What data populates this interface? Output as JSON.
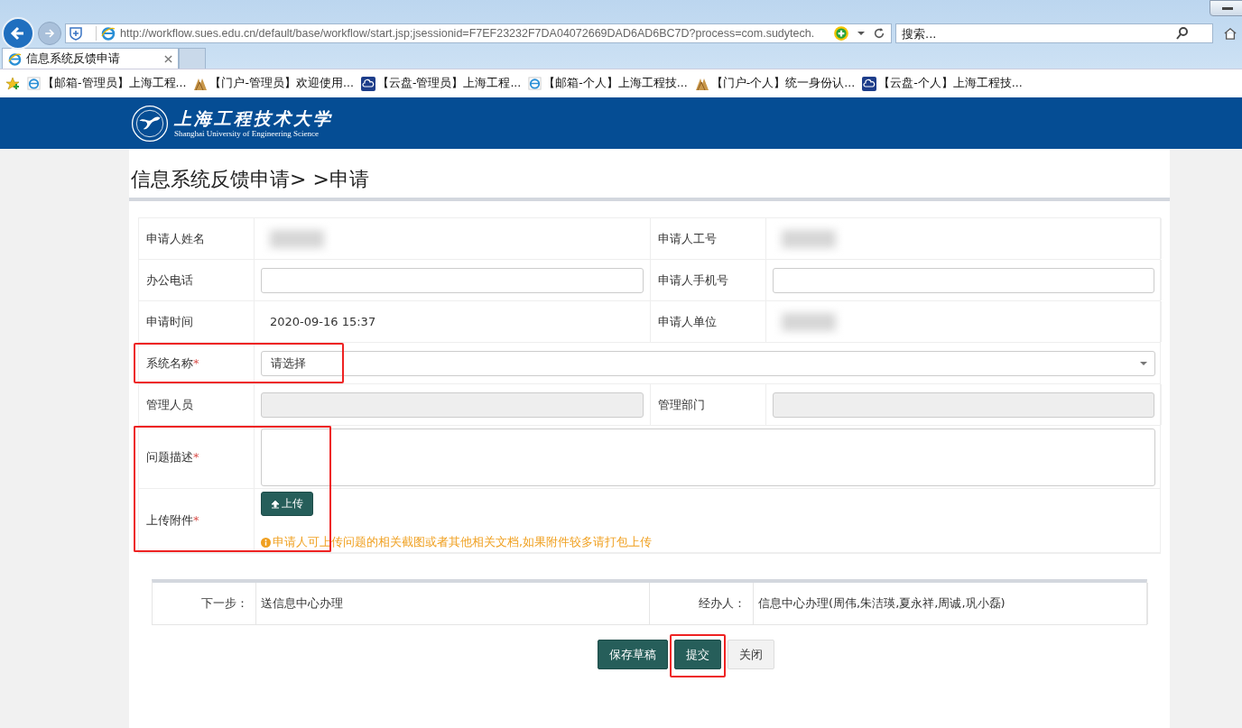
{
  "browser": {
    "address": "http://workflow.sues.edu.cn/default/base/workflow/start.jsp;jsessionid=F7EF23232F7DA04072669DAD6AD6BC7D?process=com.sudytech.",
    "search_placeholder": "搜索...",
    "tabs": [
      {
        "label": "信息系统反馈申请",
        "selected": true
      }
    ],
    "favorites": [
      {
        "label": "【邮箱-管理员】上海工程...",
        "kind": "ie"
      },
      {
        "label": "【门户-管理员】欢迎使用...",
        "kind": "portal"
      },
      {
        "label": "【云盘-管理员】上海工程...",
        "kind": "cloud"
      },
      {
        "label": "【邮箱-个人】上海工程技...",
        "kind": "ie"
      },
      {
        "label": "【门户-个人】统一身份认...",
        "kind": "portal"
      },
      {
        "label": "【云盘-个人】上海工程技...",
        "kind": "cloud"
      }
    ]
  },
  "header": {
    "logo_cn": "上海工程技术大学",
    "logo_en": "Shanghai University of Engineering Science"
  },
  "page_title": "信息系统反馈申请> >申请",
  "rows": [
    [
      {
        "label": "申请人姓名",
        "kind": "blurred",
        "highlighted": false
      },
      {
        "label": "申请人工号",
        "kind": "blurred",
        "highlighted": false
      }
    ],
    [
      {
        "label": "办公电话",
        "kind": "input",
        "disabled": false,
        "highlighted": false
      },
      {
        "label": "申请人手机号",
        "kind": "input",
        "disabled": false,
        "highlighted": false
      }
    ],
    [
      {
        "label": "申请时间",
        "kind": "text",
        "value": "2020-09-16 15:37",
        "highlighted": false
      },
      {
        "label": "申请人单位",
        "kind": "blurred",
        "highlighted": false
      }
    ],
    [
      {
        "label": "系统名称",
        "kind": "select",
        "placeholder": "请选择",
        "required_mark": "*",
        "highlighted": true
      }
    ],
    [
      {
        "label": "管理人员",
        "kind": "input",
        "disabled": true,
        "highlighted": false
      },
      {
        "label": "管理部门",
        "kind": "input",
        "disabled": true,
        "highlighted": false
      }
    ],
    [
      {
        "label": "问题描述",
        "kind": "textarea",
        "required_mark": "*",
        "highlighted": true
      }
    ],
    [
      {
        "label": "上传附件",
        "kind": "upload",
        "button": "上传",
        "hint": "申请人可上传问题的相关截图或者其他相关文档,如果附件较多请打包上传",
        "required_mark": "*",
        "highlighted": true
      }
    ]
  ],
  "footer": [
    {
      "label": "下一步：",
      "value": "送信息中心办理"
    },
    {
      "label": "经办人：",
      "value": "信息中心办理(周伟,朱洁瑛,夏永祥,周诚,巩小磊)"
    }
  ],
  "buttons": [
    {
      "label": "保存草稿",
      "kind": "primary"
    },
    {
      "label": "提交",
      "kind": "primary",
      "highlighted": true
    },
    {
      "label": "关闭",
      "kind": "default"
    }
  ]
}
